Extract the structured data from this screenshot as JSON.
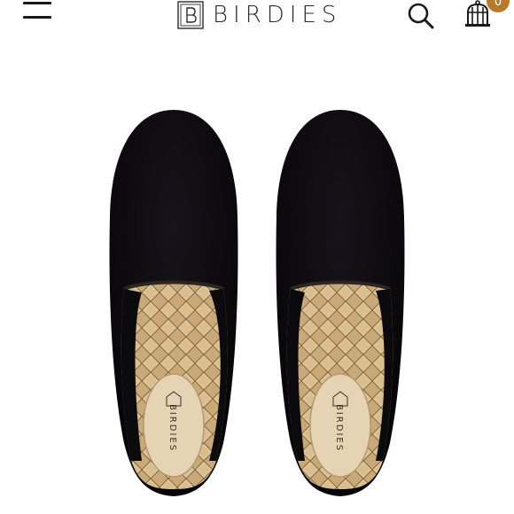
{
  "header": {
    "brand": "BIRDIES",
    "cart_count": "0"
  },
  "product": {
    "insole_brand": "BIRDIES"
  },
  "colors": {
    "velvet": "#0b0a0c",
    "satin": "#cdb085",
    "badge": "#b87a2a"
  },
  "icons": [
    "menu-icon",
    "birdcage-logo-icon",
    "search-icon",
    "birdcage-cart-icon"
  ]
}
